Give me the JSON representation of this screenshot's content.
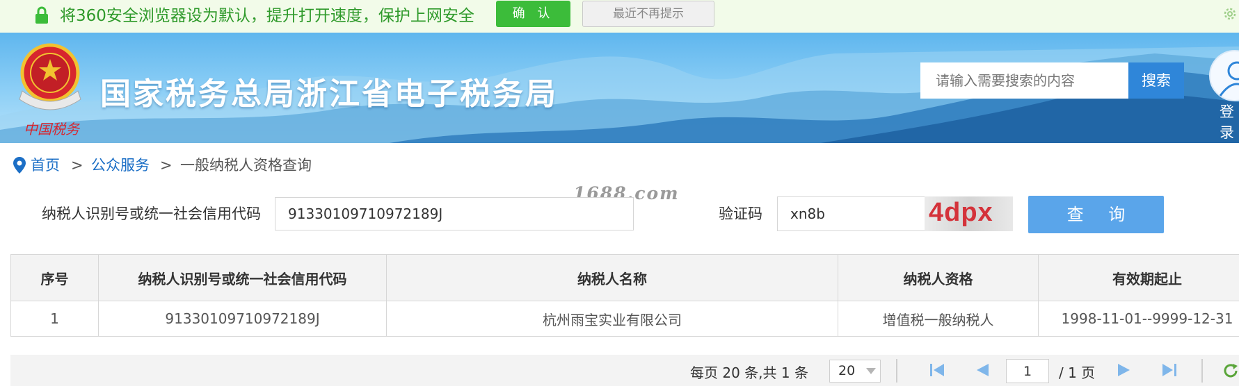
{
  "notice": {
    "message": "将360安全浏览器设为默认，提升打开速度，保护上网安全",
    "confirm_label": "确 认",
    "dismiss_label": "最近不再提示"
  },
  "header": {
    "site_title": "国家税务总局浙江省电子税务局",
    "search_placeholder": "请输入需要搜索的内容",
    "search_button": "搜索",
    "login_label": "登录"
  },
  "breadcrumb": {
    "home": "首页",
    "separator": ">",
    "section": "公众服务",
    "current": "一般纳税人资格查询"
  },
  "watermark": "1688.com",
  "form": {
    "taxpayer_id_label": "纳税人识别号或统一社会信用代码",
    "taxpayer_id_value": "91330109710972189J",
    "captcha_label": "验证码",
    "captcha_input_value": "xn8b",
    "captcha_image_text": "4dpx",
    "query_button": "查 询"
  },
  "table": {
    "columns": [
      "序号",
      "纳税人识别号或统一社会信用代码",
      "纳税人名称",
      "纳税人资格",
      "有效期起止"
    ],
    "rows": [
      [
        "1",
        "91330109710972189J",
        "杭州雨宝实业有限公司",
        "增值税一般纳税人",
        "1998-11-01--9999-12-31"
      ]
    ]
  },
  "pager": {
    "info": "每页 20 条,共 1 条",
    "page_size": "20",
    "current_page": "1",
    "total_pages": "/ 1 页"
  },
  "colors": {
    "accent_blue": "#2f86d9",
    "query_button": "#5aa5ea",
    "notice_green": "#3cbc3a",
    "link_blue": "#1c6fc6"
  }
}
